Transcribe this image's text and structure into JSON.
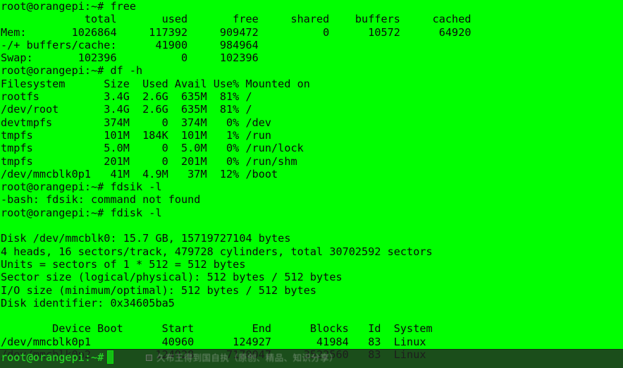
{
  "terminal": {
    "background_color": "#00ff00",
    "text_color": "#0a0a0a",
    "prompt": "root@orangepi:~# ",
    "lines": [
      "root@orangepi:~# free",
      "             total       used       free     shared    buffers     cached",
      "Mem:       1026864     117392     909472          0      10572      64920",
      "-/+ buffers/cache:      41900     984964",
      "Swap:       102396          0     102396",
      "root@orangepi:~# df -h",
      "Filesystem      Size  Used Avail Use% Mounted on",
      "rootfs          3.4G  2.6G  635M  81% /",
      "/dev/root       3.4G  2.6G  635M  81% /",
      "devtmpfs        374M     0  374M   0% /dev",
      "tmpfs           101M  184K  101M   1% /run",
      "tmpfs           5.0M     0  5.0M   0% /run/lock",
      "tmpfs           201M     0  201M   0% /run/shm",
      "/dev/mmcblk0p1   41M  4.9M   37M  12% /boot",
      "root@orangepi:~# fdsik -l",
      "-bash: fdsik: command not found",
      "root@orangepi:~# fdisk -l",
      "",
      "Disk /dev/mmcblk0: 15.7 GB, 15719727104 bytes",
      "4 heads, 16 sectors/track, 479728 cylinders, total 30702592 sectors",
      "Units = sectors of 1 * 512 = 512 bytes",
      "Sector size (logical/physical): 512 bytes / 512 bytes",
      "I/O size (minimum/optimal): 512 bytes / 512 bytes",
      "Disk identifier: 0x34605ba5",
      "",
      "        Device Boot      Start         End      Blocks   Id  System",
      "/dev/mmcblk0p1           40960      124927       41984   83  Linux",
      "/dev/mmcblk0p2          124928     7170047     3522560   83  Linux"
    ],
    "commands": [
      {
        "name": "free",
        "text": "free"
      },
      {
        "name": "df",
        "text": "df -h"
      },
      {
        "name": "fdsik-typo",
        "text": "fdsik -l"
      },
      {
        "name": "fdisk",
        "text": "fdisk -l"
      }
    ],
    "free_output": {
      "headers": [
        "total",
        "used",
        "free",
        "shared",
        "buffers",
        "cached"
      ],
      "rows": [
        {
          "label": "Mem:",
          "total": "1026864",
          "used": "117392",
          "free": "909472",
          "shared": "0",
          "buffers": "10572",
          "cached": "64920"
        },
        {
          "label": "-/+ buffers/cache:",
          "used": "41900",
          "free": "984964"
        },
        {
          "label": "Swap:",
          "total": "102396",
          "used": "0",
          "free": "102396"
        }
      ]
    },
    "df_output": {
      "headers": [
        "Filesystem",
        "Size",
        "Used",
        "Avail",
        "Use%",
        "Mounted on"
      ],
      "rows": [
        [
          "rootfs",
          "3.4G",
          "2.6G",
          "635M",
          "81%",
          "/"
        ],
        [
          "/dev/root",
          "3.4G",
          "2.6G",
          "635M",
          "81%",
          "/"
        ],
        [
          "devtmpfs",
          "374M",
          "0",
          "374M",
          "0%",
          "/dev"
        ],
        [
          "tmpfs",
          "101M",
          "184K",
          "101M",
          "1%",
          "/run"
        ],
        [
          "tmpfs",
          "5.0M",
          "0",
          "5.0M",
          "0%",
          "/run/lock"
        ],
        [
          "tmpfs",
          "201M",
          "0",
          "201M",
          "0%",
          "/run/shm"
        ],
        [
          "/dev/mmcblk0p1",
          "41M",
          "4.9M",
          "37M",
          "12%",
          "/boot"
        ]
      ]
    },
    "error_message": "-bash: fdsik: command not found",
    "fdisk_output": {
      "disk": "Disk /dev/mmcblk0: 15.7 GB, 15719727104 bytes",
      "geometry": "4 heads, 16 sectors/track, 479728 cylinders, total 30702592 sectors",
      "units": "Units = sectors of 1 * 512 = 512 bytes",
      "sector_size": "Sector size (logical/physical): 512 bytes / 512 bytes",
      "io_size": "I/O size (minimum/optimal): 512 bytes / 512 bytes",
      "identifier": "Disk identifier: 0x34605ba5",
      "partition_headers": [
        "Device Boot",
        "Start",
        "End",
        "Blocks",
        "Id",
        "System"
      ],
      "partitions": [
        [
          "/dev/mmcblk0p1",
          "40960",
          "124927",
          "41984",
          "83",
          "Linux"
        ],
        [
          "/dev/mmcblk0p2",
          "124928",
          "7170047",
          "3522560",
          "83",
          "Linux"
        ]
      ]
    }
  },
  "bottom_bar": {
    "prompt": "root@orangepi:~#",
    "watermark": "久布王得到国自执（原创、精品、知识分享）",
    "background_color": "#222222"
  }
}
